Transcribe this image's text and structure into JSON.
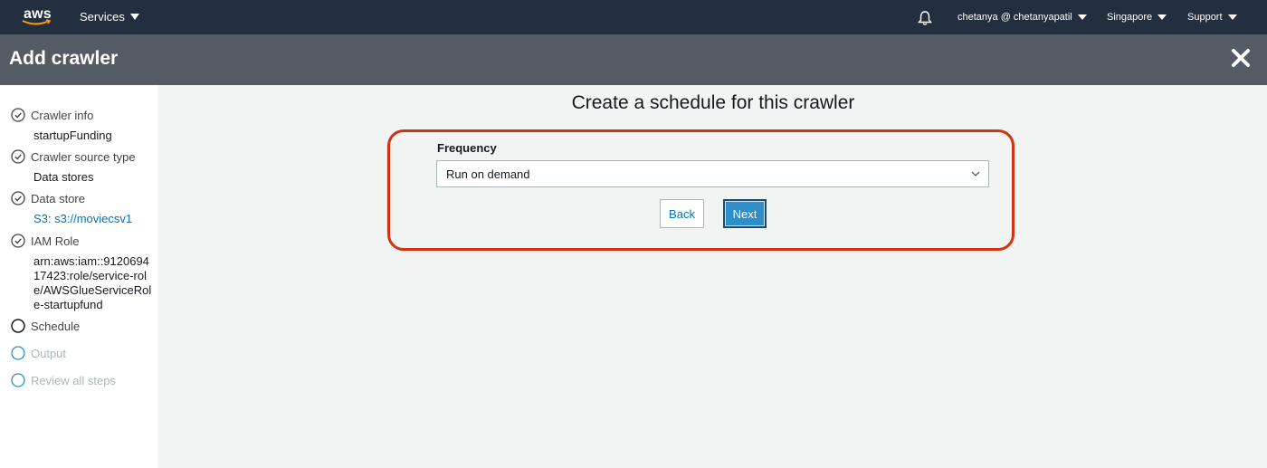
{
  "nav": {
    "logo": "aws",
    "services": "Services",
    "user": "chetanya @ chetanyapatil",
    "region": "Singapore",
    "support": "Support"
  },
  "header": {
    "title": "Add crawler"
  },
  "sidebar": {
    "steps": [
      {
        "label": "Crawler info",
        "value": "startupFunding",
        "status": "complete"
      },
      {
        "label": "Crawler source type",
        "value": "Data stores",
        "status": "complete"
      },
      {
        "label": "Data store",
        "value": "S3: s3://moviecsv1",
        "status": "complete"
      },
      {
        "label": "IAM Role",
        "value": "arn:aws:iam::912069417423:role/service-role/AWSGlueServiceRole-startupfund",
        "status": "complete"
      },
      {
        "label": "Schedule",
        "status": "current"
      },
      {
        "label": "Output",
        "status": "pending"
      },
      {
        "label": "Review all steps",
        "status": "pending"
      }
    ]
  },
  "main": {
    "title": "Create a schedule for this crawler",
    "frequency_label": "Frequency",
    "frequency_value": "Run on demand",
    "back_label": "Back",
    "next_label": "Next"
  },
  "colors": {
    "nav_bg": "#232f3e",
    "header_bg": "#545b64",
    "highlight": "#d13212",
    "link": "#0073bb",
    "primary_button": "#2e8ec9"
  }
}
